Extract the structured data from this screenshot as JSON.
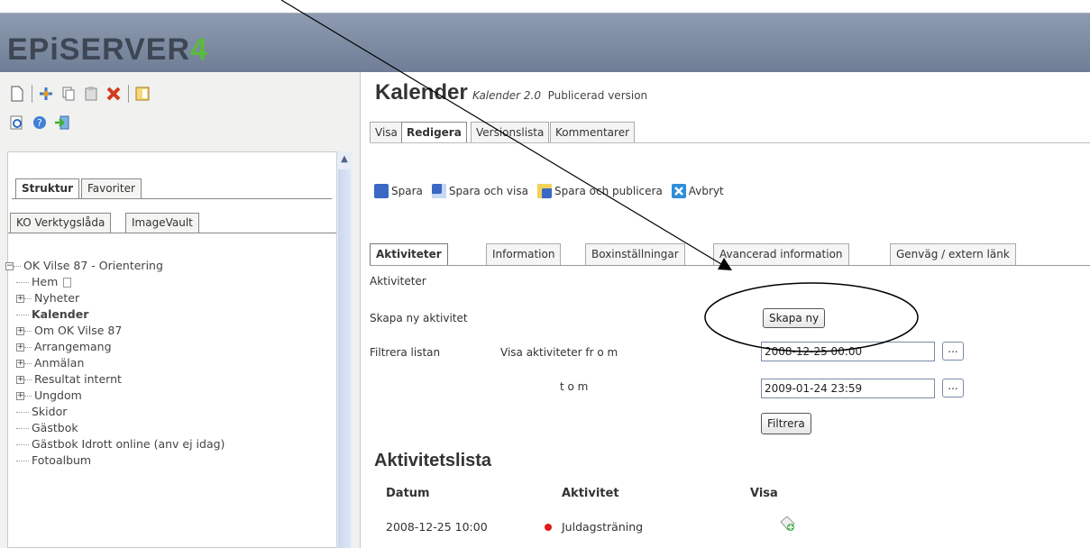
{
  "header": {
    "logo_text": "EPiSERVER",
    "logo_version": "4"
  },
  "left_panel": {
    "toolbar_icons": [
      "new-page-icon",
      "move-page-icon",
      "copy-page-icon",
      "paste-page-icon",
      "delete-page-icon",
      "view-panel-icon"
    ],
    "toolbar2_icons": [
      "preview-icon",
      "help-icon",
      "logout-icon"
    ],
    "tabs": [
      "Struktur",
      "Favoriter"
    ],
    "subtabs": [
      "KO Verktygslåda",
      "ImageVault"
    ],
    "tree": {
      "root": "OK Vilse 87 - Orientering",
      "items": [
        {
          "label": "Hem",
          "expandable": false,
          "bold": false
        },
        {
          "label": "Nyheter",
          "expandable": true,
          "bold": false
        },
        {
          "label": "Kalender",
          "expandable": false,
          "bold": true
        },
        {
          "label": "Om OK Vilse 87",
          "expandable": true,
          "bold": false
        },
        {
          "label": "Arrangemang",
          "expandable": true,
          "bold": false
        },
        {
          "label": "Anmälan",
          "expandable": true,
          "bold": false
        },
        {
          "label": "Resultat internt",
          "expandable": true,
          "bold": false
        },
        {
          "label": "Ungdom",
          "expandable": true,
          "bold": false
        },
        {
          "label": "Skidor",
          "expandable": false,
          "bold": false
        },
        {
          "label": "Gästbok",
          "expandable": false,
          "bold": false
        },
        {
          "label": "Gästbok Idrott online (anv ej idag)",
          "expandable": false,
          "bold": false
        },
        {
          "label": "Fotoalbum",
          "expandable": false,
          "bold": false
        }
      ]
    }
  },
  "page": {
    "title": "Kalender",
    "template": "Kalender 2.0",
    "status": "Publicerad version",
    "function_tabs": [
      "Visa",
      "Redigera",
      "Versionslista",
      "Kommentarer"
    ],
    "toolbar": {
      "save": "Spara",
      "save_view": "Spara och visa",
      "save_publish": "Spara och publicera",
      "cancel": "Avbryt"
    },
    "property_tabs": [
      "Aktiviteter",
      "Information",
      "Boxinställningar",
      "Avancerad information",
      "Genväg / extern länk"
    ],
    "section_label": "Aktiviteter",
    "create_label": "Skapa ny aktivitet",
    "create_button": "Skapa ny",
    "filter_label": "Filtrera listan",
    "from_label": "Visa aktiviteter fr o m",
    "to_label": "t o m",
    "from_value": "2008-12-25 00:00",
    "to_value": "2009-01-24 23:59",
    "ellipsis": "...",
    "filter_button": "Filtrera",
    "list_title": "Aktivitetslista",
    "columns": [
      "Datum",
      "Aktivitet",
      "Visa"
    ],
    "rows": [
      {
        "date": "2008-12-25 10:00",
        "activity": "Juldagsträning"
      }
    ]
  }
}
